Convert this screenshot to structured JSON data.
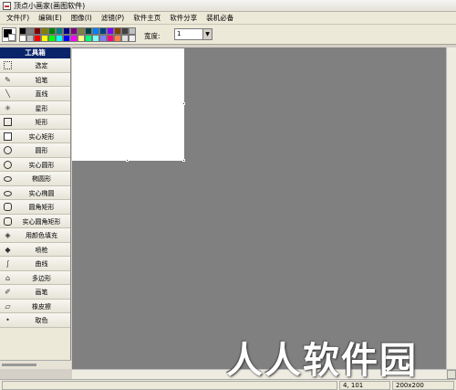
{
  "window": {
    "title": "顶点小画家(画图软件)"
  },
  "menubar": {
    "items": [
      "文件(F)",
      "编辑(E)",
      "图像(I)",
      "滤镜(P)",
      "软件主页",
      "软件分享",
      "装机必备"
    ]
  },
  "palette": {
    "current_foreground": "#000000",
    "current_background": "#ffffff",
    "colors": [
      "#000000",
      "#808080",
      "#800000",
      "#808000",
      "#008000",
      "#008080",
      "#000080",
      "#800080",
      "#808040",
      "#004040",
      "#0080ff",
      "#004080",
      "#8000ff",
      "#804000",
      "#404040",
      "#c0c0c0",
      "#ffffff",
      "#c0c0c0",
      "#ff0000",
      "#ffff00",
      "#00ff00",
      "#00ffff",
      "#0000ff",
      "#ff00ff",
      "#ffff80",
      "#00ff80",
      "#80ffff",
      "#8080ff",
      "#ff0080",
      "#ff8040",
      "#e0e0e0",
      "#f0f0f0"
    ]
  },
  "width_control": {
    "label": "宽度:",
    "value": "1"
  },
  "toolbox": {
    "header": "工具箱",
    "tools": [
      {
        "label": "选定",
        "icon": "dotted-rectangle-icon"
      },
      {
        "label": "铅笔",
        "icon": "pencil-icon"
      },
      {
        "label": "直线",
        "icon": "line-icon"
      },
      {
        "label": "星形",
        "icon": "star-icon"
      },
      {
        "label": "矩形",
        "icon": "rectangle-icon"
      },
      {
        "label": "实心矩形",
        "icon": "filled-rectangle-icon"
      },
      {
        "label": "圆形",
        "icon": "circle-icon"
      },
      {
        "label": "实心圆形",
        "icon": "filled-circle-icon"
      },
      {
        "label": "椭圆形",
        "icon": "ellipse-icon"
      },
      {
        "label": "实心椭圆",
        "icon": "filled-ellipse-icon"
      },
      {
        "label": "圆角矩形",
        "icon": "rounded-rectangle-icon"
      },
      {
        "label": "实心圆角矩形",
        "icon": "filled-rounded-rectangle-icon"
      },
      {
        "label": "用颜色填充",
        "icon": "fill-bucket-icon"
      },
      {
        "label": "喷枪",
        "icon": "airbrush-icon"
      },
      {
        "label": "曲线",
        "icon": "curve-icon"
      },
      {
        "label": "多边形",
        "icon": "polygon-icon"
      },
      {
        "label": "画笔",
        "icon": "brush-icon"
      },
      {
        "label": "橡皮擦",
        "icon": "eraser-icon"
      },
      {
        "label": "取色",
        "icon": "picker-icon"
      }
    ]
  },
  "statusbar": {
    "coords": "4, 101",
    "size": "200x200"
  },
  "watermark": "人人软件园"
}
